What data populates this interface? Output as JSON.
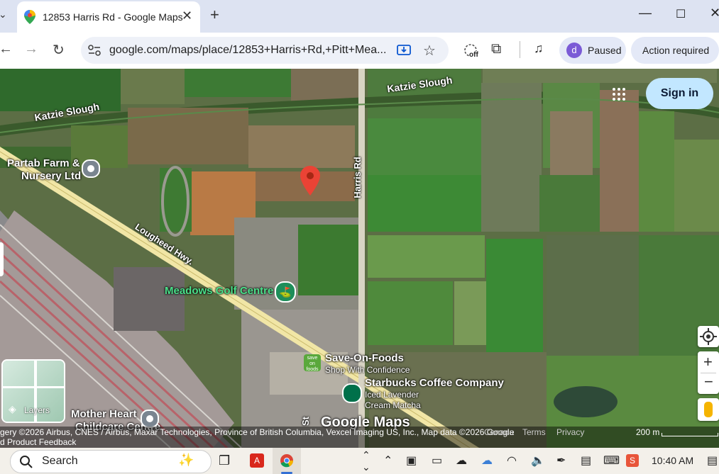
{
  "browser": {
    "tab_title": "12853 Harris Rd - Google Maps",
    "url": "google.com/maps/place/12853+Harris+Rd,+Pitt+Mea...",
    "profile_initial": "d",
    "profile_status": "Paused",
    "action_label": "Action required",
    "cast_off": "off"
  },
  "map": {
    "sign_in": "Sign in",
    "layers_label": "Layers",
    "streets": {
      "katzie_left": "Katzie Slough",
      "katzie_right": "Katzie Slough",
      "harris": "Harris Rd",
      "lougheed": "Lougheed Hwy.",
      "st": "St"
    },
    "places": {
      "partab_1": "Partab Farm &",
      "partab_2": "Nursery Ltd",
      "meadows": "Meadows Golf Centre",
      "saveon": "Save-On-Foods",
      "saveon_sub": "Shop With Confidence",
      "saveon_logo": "save on foods",
      "starbucks": "Starbucks Coffee Company",
      "starbucks_sub1": "Iced Lavender",
      "starbucks_sub2": "Cream Matcha",
      "mother_1": "Mother Heart",
      "mother_2": "Childcare Centre"
    },
    "logo": "Google Maps",
    "attribution": {
      "imagery": "gery ©2026 Airbus, CNES / Airbus, Maxar Technologies, Province of British Columbia, Vexcel Imaging US, Inc., Map data ©2026 Google",
      "country": "Canada",
      "terms": "Terms",
      "privacy": "Privacy",
      "scale": "200 m",
      "feedback": "d Product Feedback"
    },
    "colors": {
      "pin": "#ea4335",
      "highway": "#f1e6a6",
      "accent": "#0b57d0"
    }
  },
  "taskbar": {
    "search": "Search",
    "time": "10:40 AM"
  }
}
